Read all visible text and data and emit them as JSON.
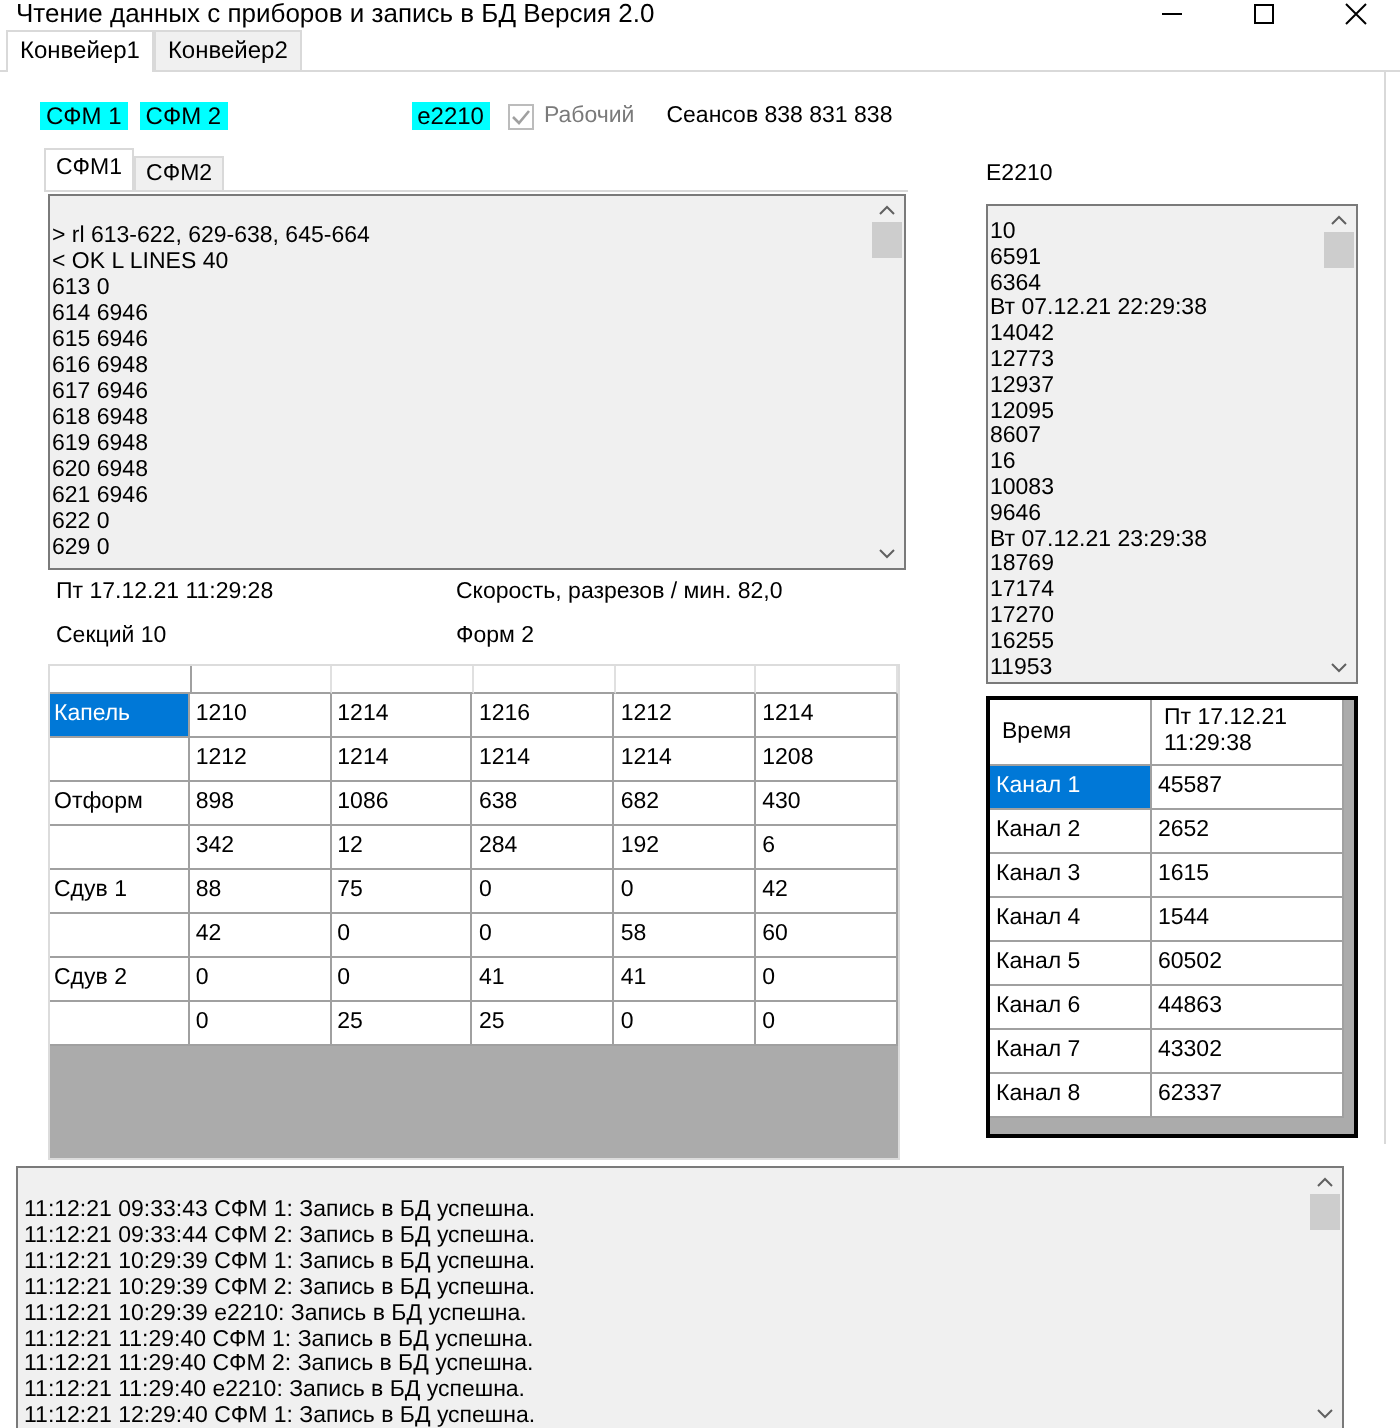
{
  "window": {
    "title": "Чтение данных с приборов и запись в БД Версия 2.0"
  },
  "tabs": [
    {
      "label": "Конвейер1",
      "selected": true
    },
    {
      "label": "Конвейер2",
      "selected": false
    }
  ],
  "indicators": [
    {
      "label": "СФМ 1",
      "on": true
    },
    {
      "label": "СФМ 2",
      "on": true
    },
    {
      "label": "e2210",
      "on": true
    }
  ],
  "working": {
    "label": "Рабочий",
    "checked": true,
    "disabled": true
  },
  "sessions": "Сеансов 838 831 838",
  "device_tabs": [
    {
      "label": "СФМ1",
      "selected": true
    },
    {
      "label": "СФМ2",
      "selected": false
    }
  ],
  "device_log": {
    "lines": [
      "> rl 613-622, 629-638, 645-664",
      "< OK L LINES 40",
      "613 0",
      "614 6946",
      "615 6946",
      "616 6948",
      "617 6946",
      "618 6948",
      "619 6948",
      "620 6948",
      "621 6946",
      "622 0",
      "629 0"
    ]
  },
  "timestamp": "Пт 17.12.21 11:29:28",
  "speed": "Скорость, разрезов / мин. 82,0",
  "sections": "Секций 10",
  "forms": "Форм 2",
  "grid": {
    "rows": [
      {
        "label": "Капель",
        "selected": true,
        "values": [
          "1210",
          "1214",
          "1216",
          "1212",
          "1214"
        ]
      },
      {
        "selected": false,
        "values": [
          "1212",
          "1214",
          "1214",
          "1214",
          "1208"
        ]
      },
      {
        "label": "Отформ",
        "selected": false,
        "values": [
          "898",
          "1086",
          "638",
          "682",
          "430"
        ]
      },
      {
        "selected": false,
        "values": [
          "342",
          "12",
          "284",
          "192",
          "6"
        ]
      },
      {
        "label": "Сдув 1",
        "selected": false,
        "values": [
          "88",
          "75",
          "0",
          "0",
          "42"
        ]
      },
      {
        "selected": false,
        "values": [
          "42",
          "0",
          "0",
          "58",
          "60"
        ]
      },
      {
        "label": "Сдув 2",
        "selected": false,
        "values": [
          "0",
          "0",
          "41",
          "41",
          "0"
        ]
      },
      {
        "selected": false,
        "values": [
          "0",
          "25",
          "25",
          "0",
          "0"
        ]
      }
    ]
  },
  "e2210": {
    "title": "E2210",
    "lines": [
      "10",
      "6591",
      "6364",
      "Вт 07.12.21 22:29:38",
      "14042",
      "12773",
      "12937",
      "12095",
      "8607",
      "16",
      "10083",
      "9646",
      "Вт 07.12.21 23:29:38",
      "18769",
      "17174",
      "17270",
      "16255",
      "11953"
    ]
  },
  "channels": {
    "header": [
      "Время",
      "Пт 17.12.21 11:29:38"
    ],
    "rows": [
      {
        "name": "Канал 1",
        "value": "45587",
        "selected": true
      },
      {
        "name": "Канал 2",
        "value": "2652",
        "selected": false
      },
      {
        "name": "Канал 3",
        "value": "1615",
        "selected": false
      },
      {
        "name": "Канал 4",
        "value": "1544",
        "selected": false
      },
      {
        "name": "Канал 5",
        "value": "60502",
        "selected": false
      },
      {
        "name": "Канал 6",
        "value": "44863",
        "selected": false
      },
      {
        "name": "Канал 7",
        "value": "43302",
        "selected": false
      },
      {
        "name": "Канал 8",
        "value": "62337",
        "selected": false
      }
    ]
  },
  "event_log": {
    "lines": [
      "11:12:21 09:33:43 СФМ 1: Запись в БД успешна.",
      "11:12:21 09:33:44 СФМ 2: Запись в БД успешна.",
      "11:12:21 10:29:39 СФМ 1: Запись в БД успешна.",
      "11:12:21 10:29:39 СФМ 2: Запись в БД успешна.",
      "11:12:21 10:29:39 e2210: Запись в БД успешна.",
      "11:12:21 11:29:40 СФМ 1: Запись в БД успешна.",
      "11:12:21 11:29:40 СФМ 2: Запись в БД успешна.",
      "11:12:21 11:29:40 e2210: Запись в БД успешна.",
      "11:12:21 12:29:40 СФМ 1: Запись в БД успешна."
    ]
  }
}
